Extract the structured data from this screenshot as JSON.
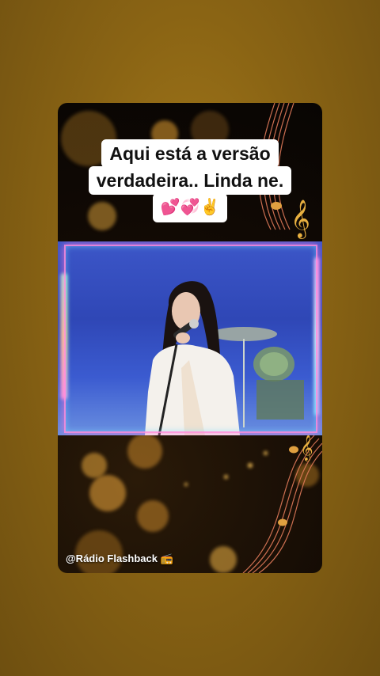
{
  "story": {
    "caption_lines": [
      "Aqui está a versão",
      "verdadeira.. Linda ne."
    ],
    "caption_emoji": "💕💞✌️",
    "handle": "@Rádio Flashback 📻"
  },
  "colors": {
    "page_background": "#8a6414",
    "card_background": "#0d0804",
    "video_background": "#3a55c6",
    "neon_frame": "#ff8cdc"
  },
  "icons": [
    "music-staff-decoration",
    "treble-clef-icon",
    "radio-icon"
  ]
}
